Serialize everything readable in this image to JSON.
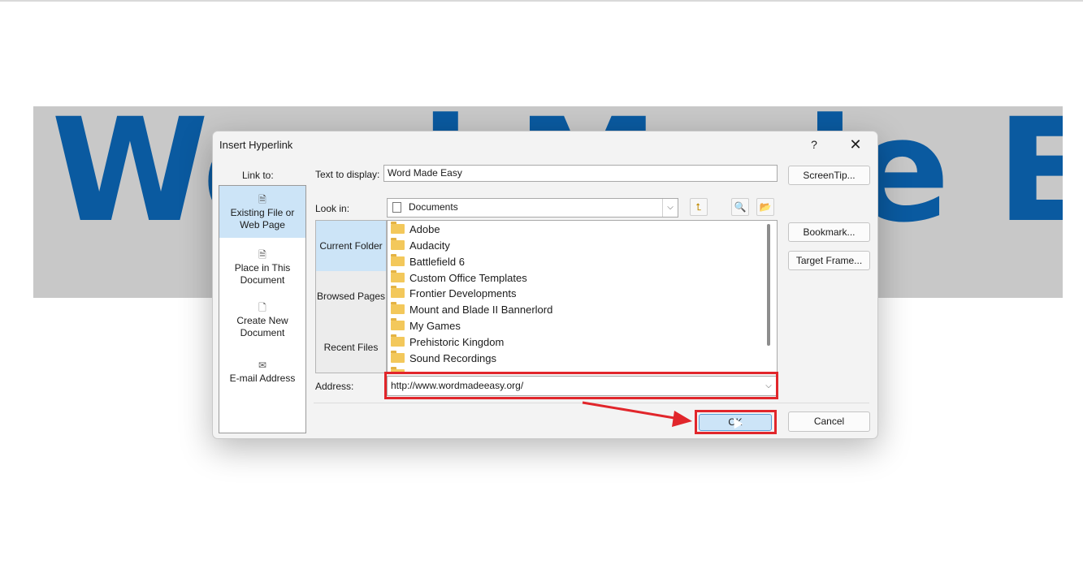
{
  "banner": {
    "text": "Word Made Easy"
  },
  "dialog": {
    "title": "Insert Hyperlink",
    "help_glyph": "?",
    "close_glyph": "✕",
    "link_to_label": "Link to:",
    "sidebar": {
      "items": [
        {
          "label_line1": "Existing File or",
          "label_line2": "Web Page",
          "icon": "existing-file-icon",
          "selected": true
        },
        {
          "label_line1": "Place in This",
          "label_line2": "Document",
          "icon": "place-in-document-icon",
          "selected": false
        },
        {
          "label_line1": "Create New",
          "label_line2": "Document",
          "icon": "create-new-document-icon",
          "selected": false
        },
        {
          "label_line1": "E-mail Address",
          "label_line2": "",
          "icon": "email-address-icon",
          "selected": false
        }
      ]
    },
    "text_to_display_label": "Text to display:",
    "text_to_display_value": "Word Made Easy",
    "screentip_button": "ScreenTip...",
    "look_in_label": "Look in:",
    "look_in_value": "Documents",
    "tabs": [
      "Current Folder",
      "Browsed Pages",
      "Recent Files"
    ],
    "files": [
      "Adobe",
      "Audacity",
      "Battlefield 6",
      "Custom Office Templates",
      "Frontier Developments",
      "Mount and Blade II Bannerlord",
      "My Games",
      "Prehistoric Kingdom",
      "Sound Recordings"
    ],
    "bookmark_button": "Bookmark...",
    "target_frame_button": "Target Frame...",
    "address_label": "Address:",
    "address_value": "http://www.wordmadeeasy.org/",
    "ok_button": "OK",
    "cancel_button": "Cancel"
  },
  "colors": {
    "banner_text": "#0a5aa0",
    "banner_bg": "#c8c8c8",
    "highlight_red": "#e1262b",
    "selection_blue": "#cce4f7"
  }
}
